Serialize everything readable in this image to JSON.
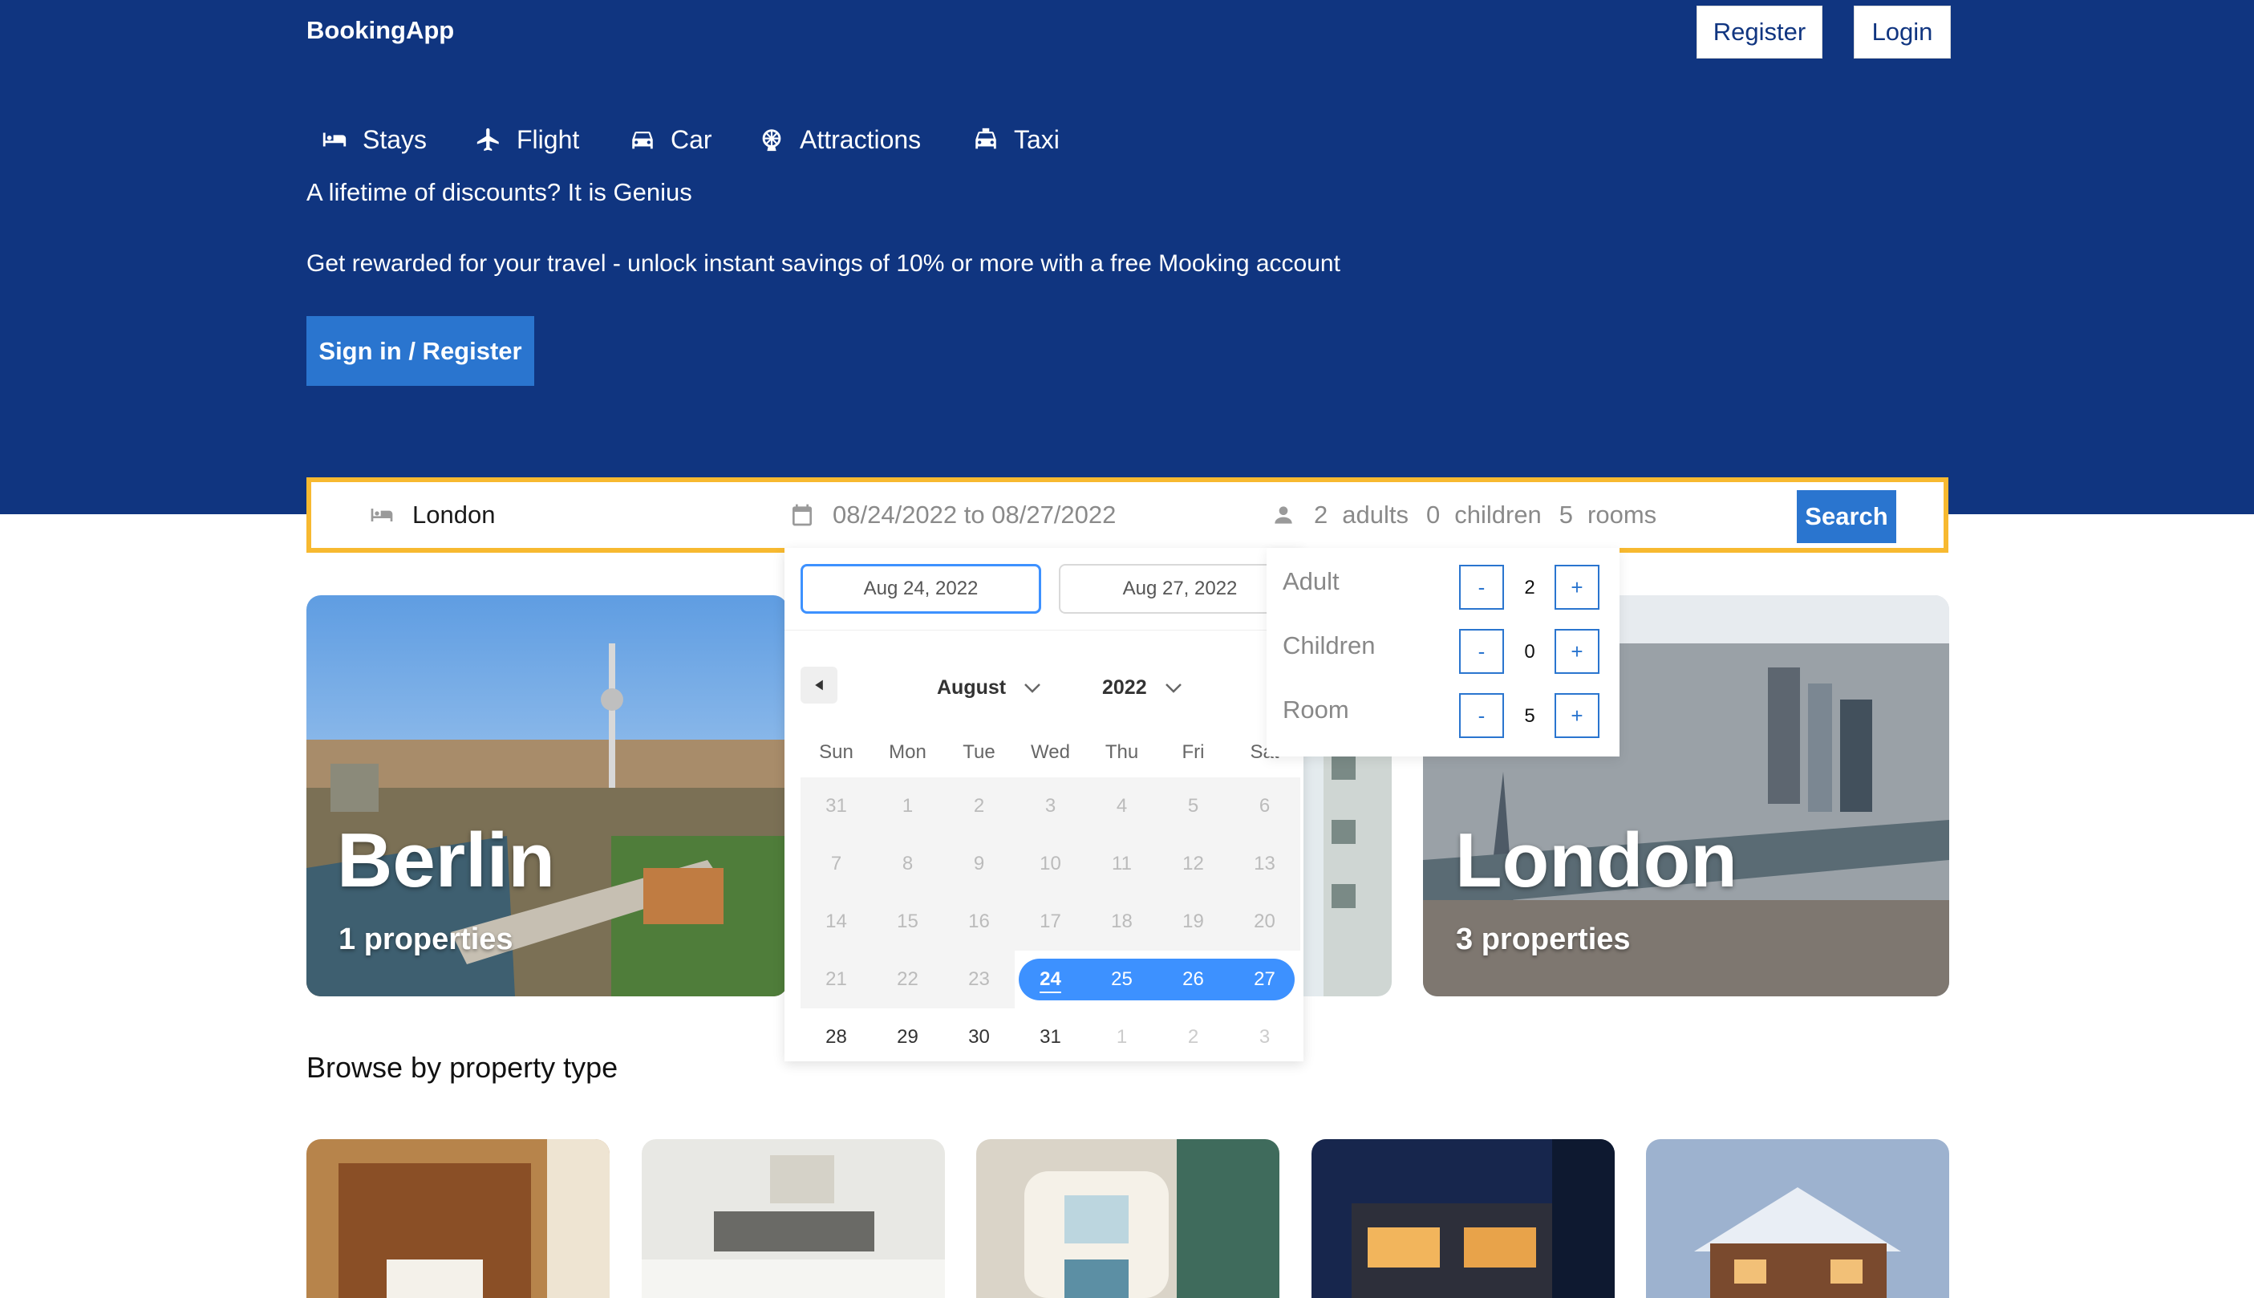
{
  "brand": "BookingApp",
  "header": {
    "register": "Register",
    "login": "Login"
  },
  "nav": [
    {
      "label": "Stays",
      "icon": "bed-icon"
    },
    {
      "label": "Flight",
      "icon": "plane-icon"
    },
    {
      "label": "Car",
      "icon": "car-icon"
    },
    {
      "label": "Attractions",
      "icon": "ferris-wheel-icon"
    },
    {
      "label": "Taxi",
      "icon": "taxi-icon"
    }
  ],
  "hero": {
    "title": "A lifetime of discounts? It is Genius",
    "description": "Get rewarded for your travel - unlock instant savings of 10% or more with a free Mooking account",
    "button": "Sign in / Register"
  },
  "search": {
    "destination": "London",
    "dates": "08/24/2022 to 08/27/2022",
    "adults": "2",
    "adults_label": "adults",
    "children": "0",
    "children_label": "children",
    "rooms": "5",
    "rooms_label": "rooms",
    "button": "Search"
  },
  "datepicker": {
    "start": "Aug 24, 2022",
    "end": "Aug 27, 2022",
    "month": "August",
    "year": "2022",
    "weekdays": [
      "Sun",
      "Mon",
      "Tue",
      "Wed",
      "Thu",
      "Fri",
      "Sat"
    ],
    "weeks": [
      [
        "31",
        "1",
        "2",
        "3",
        "4",
        "5",
        "6"
      ],
      [
        "7",
        "8",
        "9",
        "10",
        "11",
        "12",
        "13"
      ],
      [
        "14",
        "15",
        "16",
        "17",
        "18",
        "19",
        "20"
      ],
      [
        "21",
        "22",
        "23",
        "24",
        "25",
        "26",
        "27"
      ],
      [
        "28",
        "29",
        "30",
        "31",
        "1",
        "2",
        "3"
      ]
    ]
  },
  "options": [
    {
      "label": "Adult",
      "value": "2",
      "minus": "-",
      "plus": "+"
    },
    {
      "label": "Children",
      "value": "0",
      "minus": "-",
      "plus": "+"
    },
    {
      "label": "Room",
      "value": "5",
      "minus": "-",
      "plus": "+"
    }
  ],
  "cities": [
    {
      "name": "Berlin",
      "properties": "1 properties"
    },
    {
      "name": "London",
      "properties": "3 properties"
    }
  ],
  "section_title": "Browse by property type",
  "colors": {
    "primary": "#103580",
    "accent": "#2a75cf",
    "highlight": "#f7b930",
    "selection": "#3d91ff"
  }
}
